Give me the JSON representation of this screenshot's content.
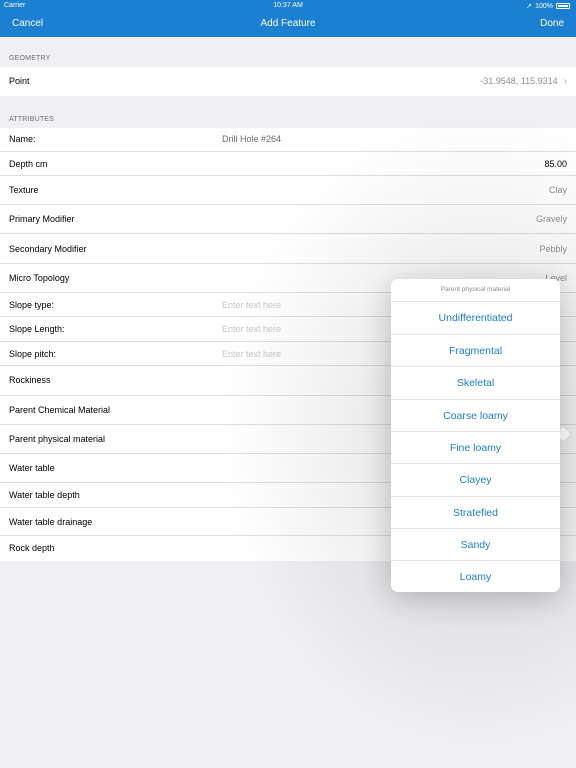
{
  "status_bar": {
    "carrier": "Carrier",
    "time": "10:37 AM",
    "battery": "100%"
  },
  "nav": {
    "cancel": "Cancel",
    "title": "Add Feature",
    "done": "Done"
  },
  "geometry": {
    "header": "GEOMETRY",
    "point_label": "Point",
    "point_value": "-31.9548, 115.9314"
  },
  "attributes": {
    "header": "ATTRIBUTES",
    "rows": [
      {
        "label": "Name:",
        "mid": "Drill Hole #264",
        "value": ""
      },
      {
        "label": "Depth cm",
        "mid": "",
        "value": "85.00"
      },
      {
        "label": "Texture",
        "mid": "",
        "value": "Clay"
      },
      {
        "label": "Primary Modifier",
        "mid": "",
        "value": "Gravely"
      },
      {
        "label": "Secondary Modifier",
        "mid": "",
        "value": "Pebbly"
      },
      {
        "label": "Micro Topology",
        "mid": "",
        "value": "Level"
      },
      {
        "label": "Slope type:",
        "placeholder": "Enter text here",
        "value": ""
      },
      {
        "label": "Slope Length:",
        "placeholder": "Enter text here",
        "value": ""
      },
      {
        "label": "Slope pitch:",
        "placeholder": "Enter text here",
        "value": ""
      },
      {
        "label": "Rockiness",
        "mid": "",
        "value": ""
      },
      {
        "label": "Parent Chemical Material",
        "mid": "",
        "value": ""
      },
      {
        "label": "Parent physical material",
        "mid": "",
        "value": ""
      },
      {
        "label": "Water table",
        "mid": "",
        "value": ""
      },
      {
        "label": "Water table depth",
        "mid": "",
        "value": ""
      },
      {
        "label": "Water table drainage",
        "mid": "",
        "value": ""
      },
      {
        "label": "Rock depth",
        "mid": "",
        "value": ""
      }
    ]
  },
  "popover": {
    "title": "Parent physical material",
    "options": [
      "Undifferentiated",
      "Fragmental",
      "Skeletal",
      "Coarse loamy",
      "Fine loamy",
      "Clayey",
      "Stratefied",
      "Sandy",
      "Loamy"
    ]
  },
  "colors": {
    "accent": "#1b7fd2",
    "background": "#efeff4"
  }
}
